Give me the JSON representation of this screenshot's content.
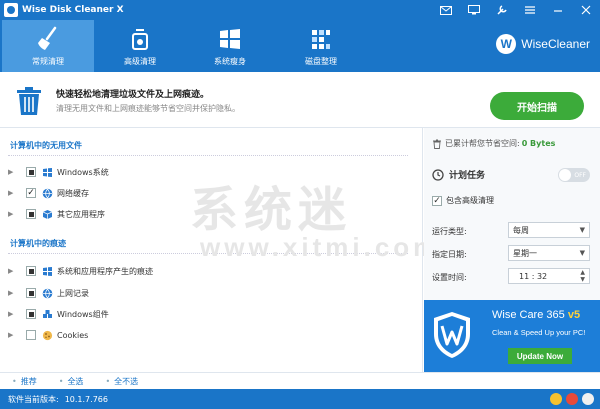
{
  "window": {
    "title": "Wise Disk Cleaner X"
  },
  "tabs": [
    {
      "label": "常规清理",
      "icon": "broom-icon",
      "active": true
    },
    {
      "label": "高级清理",
      "icon": "trash-fire-icon",
      "active": false
    },
    {
      "label": "系统瘦身",
      "icon": "windows-icon",
      "active": false
    },
    {
      "label": "磁盘整理",
      "icon": "defrag-icon",
      "active": false
    }
  ],
  "brand": {
    "name": "WiseCleaner"
  },
  "banner": {
    "title": "快速轻松地清理垃圾文件及上网痕迹。",
    "subtitle": "清理无用文件和上网痕迹能够节省空间并保护隐私。",
    "scan_button": "开始扫描"
  },
  "sections": {
    "useless": "计算机中的无用文件",
    "traces": "计算机中的痕迹"
  },
  "useless_items": [
    {
      "label": "Windows系统",
      "state": "partial"
    },
    {
      "label": "网络缓存",
      "state": "checked"
    },
    {
      "label": "其它应用程序",
      "state": "partial"
    }
  ],
  "trace_items": [
    {
      "label": "系统和应用程序产生的痕迹",
      "state": "partial"
    },
    {
      "label": "上网记录",
      "state": "partial"
    },
    {
      "label": "Windows组件",
      "state": "partial"
    },
    {
      "label": "Cookies",
      "state": "unchecked"
    }
  ],
  "watermark": {
    "line1": "系统迷",
    "line2": "www.xitmi.com"
  },
  "right": {
    "saved_label": "已累计帮您节省空间:",
    "saved_value": "0 Bytes",
    "schedule_label": "计划任务",
    "toggle_label": "OFF",
    "include_advanced": "包含高级清理",
    "run_type_label": "运行类型:",
    "run_type_value": "每周",
    "date_label": "指定日期:",
    "date_value": "星期一",
    "time_label": "设置时间:",
    "time_value": "11 : 32"
  },
  "ad": {
    "title": "Wise Care 365",
    "version": "v5",
    "tagline": "Clean & Speed Up your PC!",
    "button": "Update Now"
  },
  "links": [
    "推荐",
    "全选",
    "全不选"
  ],
  "status": {
    "version_label": "软件当前版本:",
    "version_value": "10.1.7.766"
  },
  "colors": {
    "brand_blue": "#1a75c8",
    "active_tab": "#4a9be0",
    "green": "#3cab3a"
  }
}
